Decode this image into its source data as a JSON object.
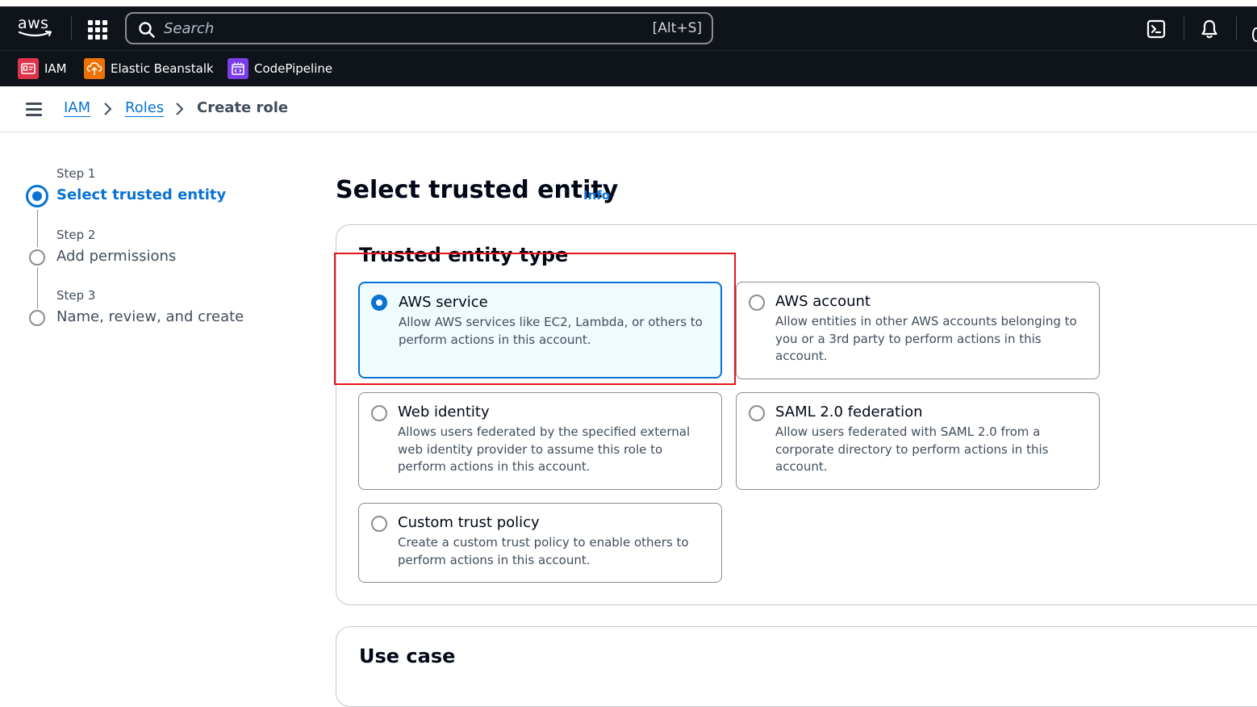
{
  "topnav": {
    "logo_text": "aws",
    "search_placeholder": "Search",
    "search_shortcut": "[Alt+S]"
  },
  "favorites": [
    {
      "label": "IAM",
      "icon": "iam-icon",
      "color": "#dd344c"
    },
    {
      "label": "Elastic Beanstalk",
      "icon": "elastic-beanstalk-icon",
      "color": "#ed7100"
    },
    {
      "label": "CodePipeline",
      "icon": "codepipeline-icon",
      "color": "#7a3ee8"
    }
  ],
  "breadcrumb": {
    "items": [
      {
        "label": "IAM",
        "link": true
      },
      {
        "label": "Roles",
        "link": true
      },
      {
        "label": "Create role",
        "link": false
      }
    ]
  },
  "wizard": {
    "steps": [
      {
        "step": "Step 1",
        "title": "Select trusted entity",
        "active": true
      },
      {
        "step": "Step 2",
        "title": "Add permissions",
        "active": false
      },
      {
        "step": "Step 3",
        "title": "Name, review, and create",
        "active": false
      }
    ]
  },
  "main": {
    "title": "Select trusted entity",
    "info": "Info",
    "trusted_entity_type": {
      "title": "Trusted entity type",
      "options": [
        {
          "name": "AWS service",
          "description": "Allow AWS services like EC2, Lambda, or others to perform actions in this account.",
          "selected": true
        },
        {
          "name": "AWS account",
          "description": "Allow entities in other AWS accounts belonging to you or a 3rd party to perform actions in this account.",
          "selected": false
        },
        {
          "name": "Web identity",
          "description": "Allows users federated by the specified external web identity provider to assume this role to perform actions in this account.",
          "selected": false
        },
        {
          "name": "SAML 2.0 federation",
          "description": "Allow users federated with SAML 2.0 from a corporate directory to perform actions in this account.",
          "selected": false
        },
        {
          "name": "Custom trust policy",
          "description": "Create a custom trust policy to enable others to perform actions in this account.",
          "selected": false
        }
      ]
    },
    "use_case": {
      "title": "Use case"
    }
  },
  "colors": {
    "accent": "#0972d3",
    "nav_bg": "#0f141a",
    "highlight": "#e3161c"
  }
}
